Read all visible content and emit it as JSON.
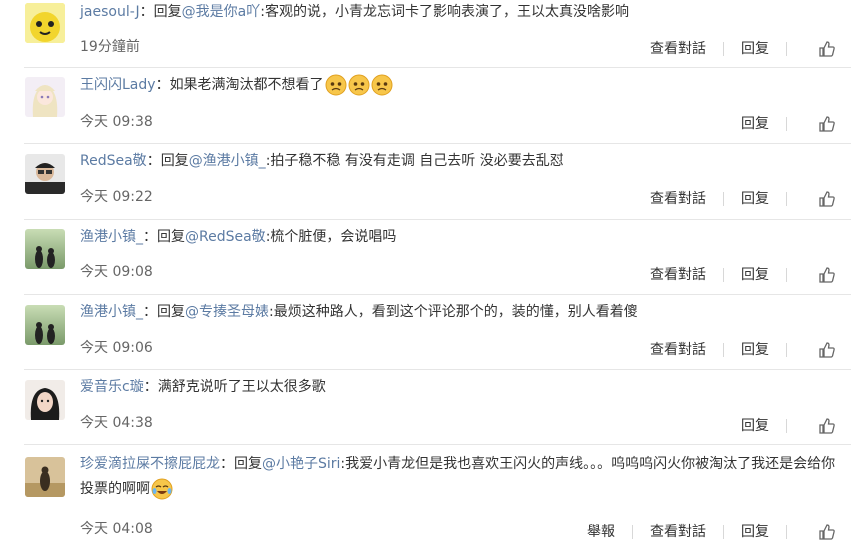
{
  "comments": [
    {
      "user": "jaesoul-J",
      "colon": "：",
      "reply_word": "回复",
      "mention": "@我是你a吖",
      "body": ":客观的说，小青龙忘词卡了影响表演了，王以太真没啥影响",
      "time": "19分鐘前",
      "actions": [
        "查看對話",
        "回复"
      ],
      "avatar": "yellow-cartoon"
    },
    {
      "user": "王闪闪Lady",
      "colon": "：",
      "reply_word": "",
      "mention": "",
      "body": "如果老满淘汰都不想看了",
      "emojis": 3,
      "time": "今天 09:38",
      "actions": [
        "回复"
      ],
      "avatar": "anime-girl"
    },
    {
      "user": "RedSea敬",
      "colon": "：",
      "reply_word": "回复",
      "mention": "@渔港小镇_",
      "body": ":拍子稳不稳 有没有走调 自己去听 没必要去乱怼",
      "time": "今天 09:22",
      "actions": [
        "查看對話",
        "回复"
      ],
      "avatar": "man-portrait"
    },
    {
      "user": "渔港小镇_",
      "colon": "：",
      "reply_word": "回复",
      "mention": "@RedSea敬",
      "body": ":梳个脏便，会说唱吗",
      "time": "今天 09:08",
      "actions": [
        "查看對話",
        "回复"
      ],
      "avatar": "silhouette-couple"
    },
    {
      "user": "渔港小镇_",
      "colon": "：",
      "reply_word": "回复",
      "mention": "@专揍圣母婊",
      "body": ":最烦这种路人，看到这个评论那个的，装的懂，别人看着傻",
      "time": "今天 09:06",
      "actions": [
        "查看對話",
        "回复"
      ],
      "avatar": "silhouette-couple"
    },
    {
      "user": "爱音乐c璇",
      "colon": "：",
      "reply_word": "",
      "mention": "",
      "body": "满舒克说听了王以太很多歌",
      "time": "今天 04:38",
      "actions": [
        "回复"
      ],
      "avatar": "girl-portrait"
    },
    {
      "user": "珍爱滴拉屎不擦屁屁龙",
      "colon": "：",
      "reply_word": "回复",
      "mention": "@小艳子Siri",
      "body": ":我爱小青龙但是我也喜欢王闪火的声线。。。呜呜呜闪火你被淘汰了我还是会给你投票的啊啊",
      "emojis_crying": 1,
      "time": "今天 04:08",
      "actions": [
        "舉報",
        "查看對話",
        "回复"
      ],
      "avatar": "field-photo"
    }
  ],
  "colors": {
    "link": "#5c7ba3",
    "text": "#333333",
    "meta": "#666666",
    "divider": "#e6e6e6"
  },
  "icons": {
    "like": "thumbs-up-icon",
    "sad_emoji": "sad-face-emoji",
    "cry_emoji": "crying-laughing-emoji"
  }
}
